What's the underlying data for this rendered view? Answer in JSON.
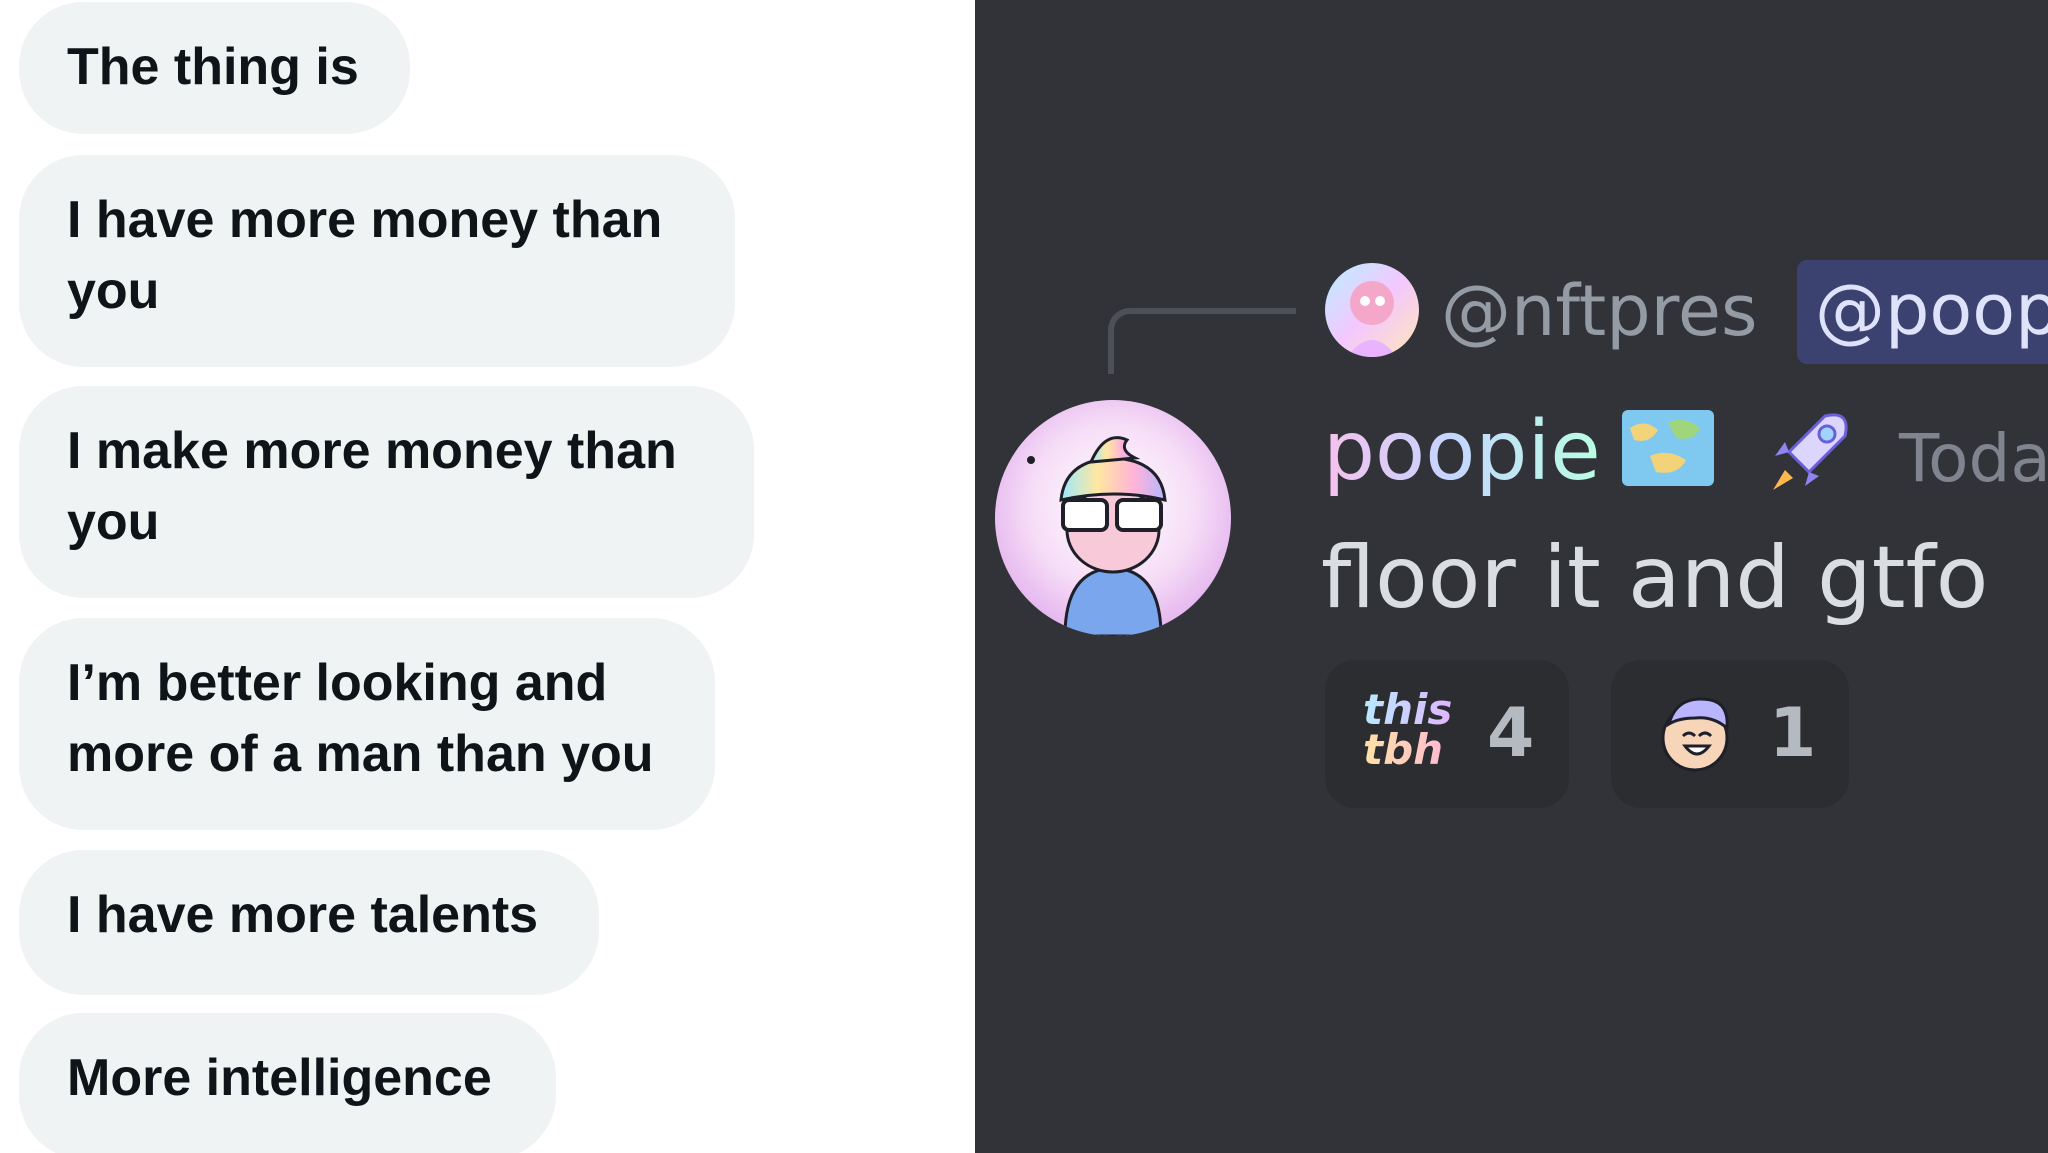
{
  "dm_thread": {
    "messages": [
      {
        "lines": [
          "The thing is"
        ]
      },
      {
        "lines": [
          "I have more money than",
          "you"
        ]
      },
      {
        "lines": [
          "I make more money than",
          "you"
        ]
      },
      {
        "lines": [
          "I’m better looking and",
          "more of a man than you"
        ]
      },
      {
        "lines": [
          "I have more talents"
        ]
      },
      {
        "lines": [
          "More intelligence"
        ]
      }
    ]
  },
  "discord": {
    "reply": {
      "author": "@nftpres",
      "mention": "@poop"
    },
    "message": {
      "username": "poopie",
      "timestamp": "Today",
      "text": "floor it and gtfo",
      "badges": [
        "map-icon",
        "rocket-icon"
      ],
      "reactions": [
        {
          "emoji_text": [
            "this",
            "tbh"
          ],
          "count": "4",
          "icon": "this-tbh-emoji"
        },
        {
          "emoji_text": [],
          "count": "1",
          "icon": "laughing-face-emoji"
        }
      ]
    },
    "colors": {
      "background": "#313338",
      "reaction_bg": "#2b2d31",
      "mention_bg": "#3c4270",
      "message_text": "#dbdee1",
      "muted_text": "#949ba4"
    }
  }
}
